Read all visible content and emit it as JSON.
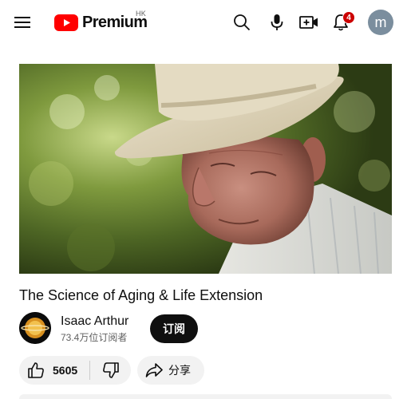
{
  "header": {
    "logo_text": "Premium",
    "region": "HK",
    "notification_count": "4",
    "avatar_letter": "m",
    "icons": [
      "menu-icon",
      "search-icon",
      "microphone-icon",
      "create-video-icon",
      "bell-icon"
    ],
    "brand_color": "#ff0000"
  },
  "video": {
    "title": "The Science of Aging & Life Extension",
    "thumbnail_subject": "elderly-man-in-straw-hat"
  },
  "channel": {
    "name": "Isaac Arthur",
    "subscribers": "73.4万位订阅者",
    "subscribe_label": "订阅"
  },
  "actions": {
    "like_count": "5605",
    "share_label": "分享"
  }
}
